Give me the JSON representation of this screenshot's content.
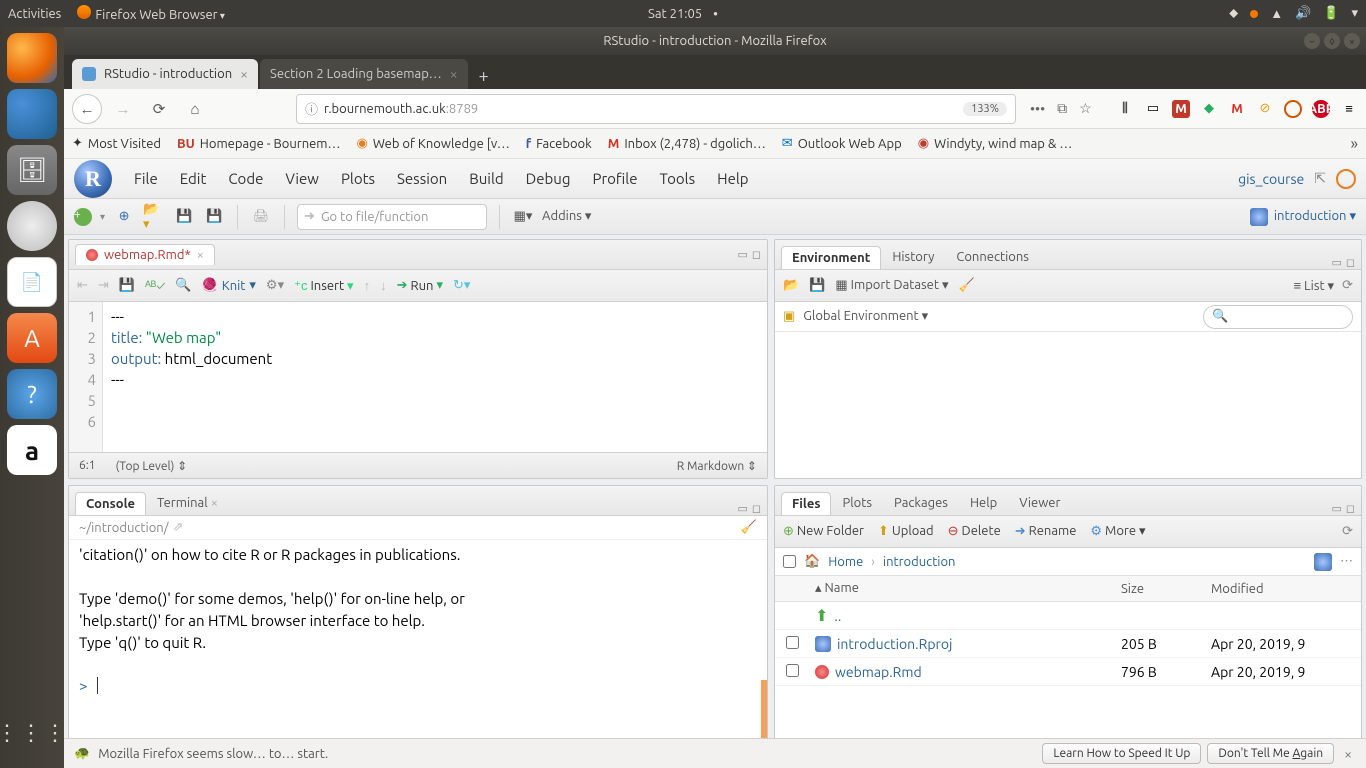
{
  "gnome": {
    "activities": "Activities",
    "app": "Firefox Web Browser",
    "clock": "Sat 21:05"
  },
  "window": {
    "title": "RStudio - introduction - Mozilla Firefox"
  },
  "tabs": {
    "active": "RStudio - introduction",
    "inactive": "Section 2 Loading basemap…"
  },
  "url": {
    "host": "r.bournemouth.ac.uk",
    "port": ":8789",
    "zoom": "133%"
  },
  "bookmarks": {
    "most_visited": "Most Visited",
    "homepage": "Homepage - Bournem…",
    "wok": "Web of Knowledge [v…",
    "facebook": "Facebook",
    "inbox": "Inbox (2,478) - dgolich…",
    "owa": "Outlook Web App",
    "windy": "Windyty, wind map & …"
  },
  "rstudio": {
    "menu": {
      "file": "File",
      "edit": "Edit",
      "code": "Code",
      "view": "View",
      "plots": "Plots",
      "session": "Session",
      "build": "Build",
      "debug": "Debug",
      "profile": "Profile",
      "tools": "Tools",
      "help": "Help"
    },
    "project_label": "gis_course",
    "goto_placeholder": "Go to file/function",
    "addins": "Addins",
    "active_doc": "introduction"
  },
  "source": {
    "tab": "webmap.Rmd*",
    "knit": "Knit",
    "insert": "Insert",
    "run": "Run",
    "lines": [
      "1",
      "2",
      "3",
      "4",
      "5",
      "6"
    ],
    "code": {
      "l1": "---",
      "l2a": "title:",
      "l2b": "\"Web map\"",
      "l3a": "output:",
      "l3b": "html_document",
      "l4": "---",
      "l5": "",
      "l6": ""
    },
    "cursor": "6:1",
    "scope": "(Top Level)",
    "lang": "R Markdown"
  },
  "env": {
    "tabs": {
      "environment": "Environment",
      "history": "History",
      "connections": "Connections"
    },
    "import": "Import Dataset",
    "list": "List",
    "scope": "Global Environment"
  },
  "console": {
    "tabs": {
      "console": "Console",
      "terminal": "Terminal"
    },
    "path": "~/introduction/",
    "body": "'citation()' on how to cite R or R packages in publications.\n\nType 'demo()' for some demos, 'help()' for on-line help, or\n'help.start()' for an HTML browser interface to help.\nType 'q()' to quit R.\n",
    "prompt": ">"
  },
  "files": {
    "tabs": {
      "files": "Files",
      "plots": "Plots",
      "packages": "Packages",
      "help": "Help",
      "viewer": "Viewer"
    },
    "tools": {
      "new_folder": "New Folder",
      "upload": "Upload",
      "delete": "Delete",
      "rename": "Rename",
      "more": "More"
    },
    "breadcrumb": {
      "home": "Home",
      "cur": "introduction"
    },
    "headers": {
      "name": "Name",
      "size": "Size",
      "modified": "Modified"
    },
    "up": "..",
    "rows": [
      {
        "name": "introduction.Rproj",
        "size": "205 B",
        "modified": "Apr 20, 2019, 9"
      },
      {
        "name": "webmap.Rmd",
        "size": "796 B",
        "modified": "Apr 20, 2019, 9"
      }
    ]
  },
  "status": {
    "msg": "Mozilla Firefox seems slow… to… start.",
    "learn": "Learn How to Speed It Up",
    "dont_a": "Don't Tell Me ",
    "dont_b": "A",
    "dont_c": "gain"
  }
}
